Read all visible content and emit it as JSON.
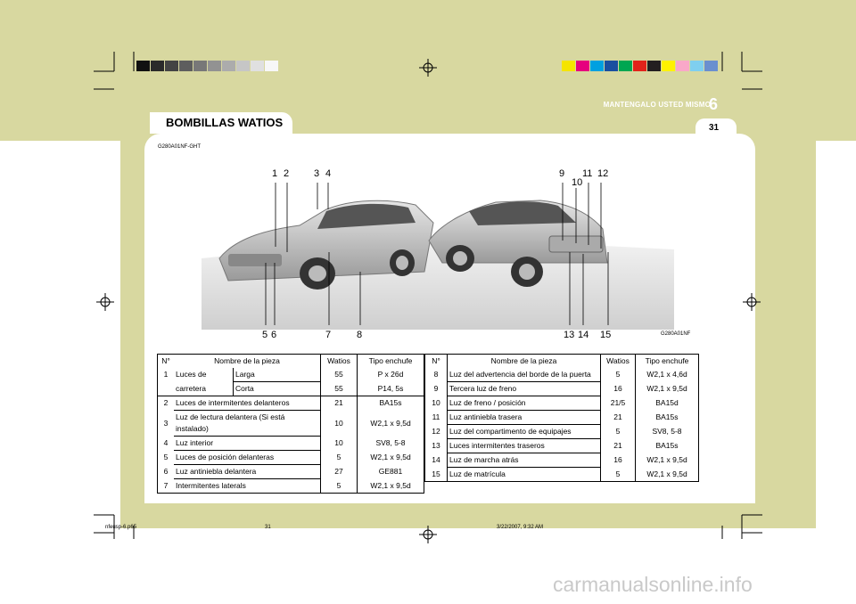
{
  "header": {
    "chapter_label": "MANTENGALO USTED MISMO",
    "chapter_number": "6",
    "page_number": "31",
    "section_title": "BOMBILLAS WATIOS",
    "doc_code": "G280A01NF-GHT"
  },
  "colors": {
    "background": "#d8d8a0",
    "gray_bar": [
      "#111111",
      "#2a2a2a",
      "#444444",
      "#5e5e5e",
      "#787878",
      "#929292",
      "#acacac",
      "#c6c6c6",
      "#e0e0e0",
      "#f7f7f7"
    ],
    "color_bar": [
      "#f5e400",
      "#e6007e",
      "#00a0e0",
      "#1a4fa0",
      "#00a651",
      "#e2231a",
      "#231f20",
      "#fff200",
      "#f9a8c8",
      "#7fcfef",
      "#6a8fcf"
    ]
  },
  "figure": {
    "image_code": "G280A01NF",
    "callouts_top": [
      "1",
      "2",
      "3",
      "4",
      "9",
      "11",
      "12",
      "10"
    ],
    "callouts_bottom": [
      "5",
      "6",
      "7",
      "8",
      "13",
      "14",
      "15"
    ]
  },
  "table_left": {
    "headers": [
      "N°",
      "Nombre de la pieza",
      "Watios",
      "Tipo enchufe"
    ],
    "rows": [
      {
        "n": "1",
        "name": "Luces de",
        "sub": "Larga",
        "w": "55",
        "t": "P x 26d"
      },
      {
        "n": "",
        "name": "carretera",
        "sub": "Corta",
        "w": "55",
        "t": "P14, 5s"
      },
      {
        "n": "2",
        "name": "Luces de intermitentes delanteros",
        "w": "21",
        "t": "BA15s"
      },
      {
        "n": "3",
        "name": "Luz de lectura delantera (Si está instalado)",
        "w": "10",
        "t": "W2,1 x 9,5d"
      },
      {
        "n": "4",
        "name": "Luz interior",
        "w": "10",
        "t": "SV8, 5-8"
      },
      {
        "n": "5",
        "name": "Luces de posición delanteras",
        "w": "5",
        "t": "W2,1 x 9,5d"
      },
      {
        "n": "6",
        "name": "Luz antiniebla delantera",
        "w": "27",
        "t": "GE881"
      },
      {
        "n": "7",
        "name": "Intermitentes laterals",
        "w": "5",
        "t": "W2,1 x 9,5d"
      }
    ]
  },
  "table_right": {
    "headers": [
      "N°",
      "Nombre de la pieza",
      "Watios",
      "Tipo enchufe"
    ],
    "rows": [
      {
        "n": "8",
        "name": "Luz del advertencia del borde de la puerta",
        "w": "5",
        "t": "W2,1 x 4,6d"
      },
      {
        "n": "9",
        "name": "Tercera luz de freno",
        "w": "16",
        "t": "W2,1 x 9,5d"
      },
      {
        "n": "10",
        "name": "Luz de freno / posición",
        "w": "21/5",
        "t": "BA15d"
      },
      {
        "n": "11",
        "name": "Luz antiniebla trasera",
        "w": "21",
        "t": "BA15s"
      },
      {
        "n": "12",
        "name": "Luz del compartimento de equipajes",
        "w": "5",
        "t": "SV8, 5-8"
      },
      {
        "n": "13",
        "name": "Luces intermitentes traseros",
        "w": "21",
        "t": "BA15s"
      },
      {
        "n": "14",
        "name": "Luz de marcha atrás",
        "w": "16",
        "t": "W2,1 x 9,5d"
      },
      {
        "n": "15",
        "name": "Luz de matrícula",
        "w": "5",
        "t": "W2,1 x 9,5d"
      }
    ]
  },
  "footer": {
    "file": "nfeusp-6.p65",
    "page": "31",
    "date": "3/22/2007, 9:32 AM"
  },
  "watermark": "carmanualsonline.info"
}
